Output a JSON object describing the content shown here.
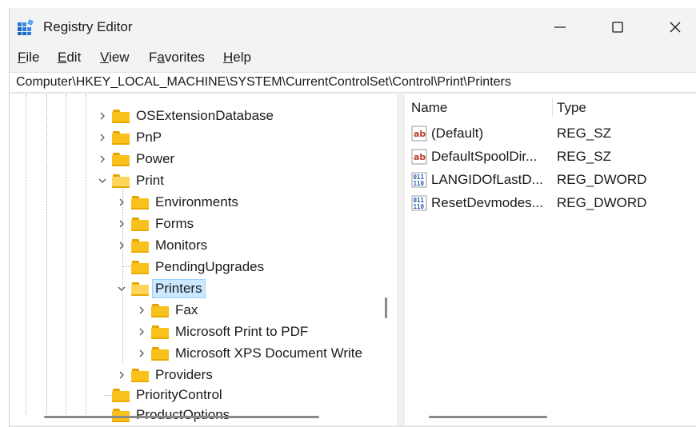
{
  "window": {
    "title": "Registry Editor",
    "controls": {
      "minimize": "—",
      "maximize": "☐",
      "close": "✕"
    }
  },
  "menu": {
    "items": [
      {
        "label": "File",
        "accel": "F",
        "rest": "ile"
      },
      {
        "label": "Edit",
        "accel": "E",
        "rest": "dit"
      },
      {
        "label": "View",
        "accel": "V",
        "rest": "iew"
      },
      {
        "label": "Favorites",
        "accel": "a",
        "pre": "F",
        "rest": "vorites"
      },
      {
        "label": "Help",
        "accel": "H",
        "rest": "elp"
      }
    ]
  },
  "address": {
    "path": "Computer\\HKEY_LOCAL_MACHINE\\SYSTEM\\CurrentControlSet\\Control\\Print\\Printers"
  },
  "tree": {
    "nodes": [
      {
        "label": "OSExtensionDatabase",
        "expanded": false
      },
      {
        "label": "PnP",
        "expanded": false
      },
      {
        "label": "Power",
        "expanded": false
      },
      {
        "label": "Print",
        "expanded": true
      },
      {
        "label": "Environments",
        "expanded": false
      },
      {
        "label": "Forms",
        "expanded": false
      },
      {
        "label": "Monitors",
        "expanded": false
      },
      {
        "label": "PendingUpgrades",
        "expanded": null
      },
      {
        "label": "Printers",
        "expanded": true,
        "selected": true
      },
      {
        "label": "Fax",
        "expanded": false
      },
      {
        "label": "Microsoft Print to PDF",
        "expanded": false
      },
      {
        "label": "Microsoft XPS Document Write",
        "expanded": false
      },
      {
        "label": "Providers",
        "expanded": false
      },
      {
        "label": "PriorityControl",
        "expanded": null
      },
      {
        "label": "ProductOptions",
        "expanded": null
      }
    ]
  },
  "list": {
    "columns": {
      "name": "Name",
      "type": "Type"
    },
    "rows": [
      {
        "name": "(Default)",
        "type": "REG_SZ",
        "icon": "string-value-icon"
      },
      {
        "name": "DefaultSpoolDir...",
        "type": "REG_SZ",
        "icon": "string-value-icon"
      },
      {
        "name": "LANGIDOfLastD...",
        "type": "REG_DWORD",
        "icon": "binary-value-icon"
      },
      {
        "name": "ResetDevmodes...",
        "type": "REG_DWORD",
        "icon": "binary-value-icon"
      }
    ]
  },
  "colors": {
    "selection": "#cce8ff",
    "folder": "#f9c11b",
    "string_icon": "#c0392b",
    "binary_icon": "#2a5db0"
  }
}
